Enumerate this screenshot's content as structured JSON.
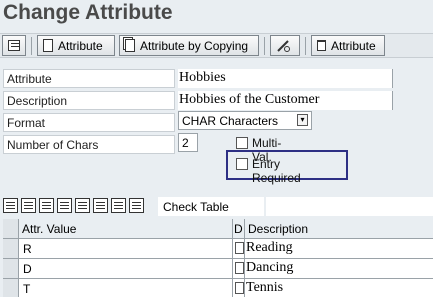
{
  "title": "Change Attribute",
  "toolbar": {
    "attribute_label": "Attribute",
    "copy_label": "Attribute by Copying",
    "delete_label": "Attribute"
  },
  "form": {
    "attribute_label": "Attribute",
    "attribute_value": "Hobbies",
    "description_label": "Description",
    "description_value": "Hobbies of the Customer",
    "format_label": "Format",
    "format_value": "CHAR Characters",
    "num_chars_label": "Number of Chars",
    "num_chars_value": "2",
    "multi_val_label": "Multi-Val.",
    "entry_required_label": "Entry Required"
  },
  "grid": {
    "check_table_label": "Check Table",
    "columns": [
      "Attr. Value",
      "D",
      "Description"
    ],
    "rows": [
      {
        "value": "R",
        "description": "Reading"
      },
      {
        "value": "D",
        "description": "Dancing"
      },
      {
        "value": "T",
        "description": "Tennis"
      }
    ]
  },
  "colors": {
    "background": "#e9eef2",
    "highlight_box": "#2d2f84"
  }
}
